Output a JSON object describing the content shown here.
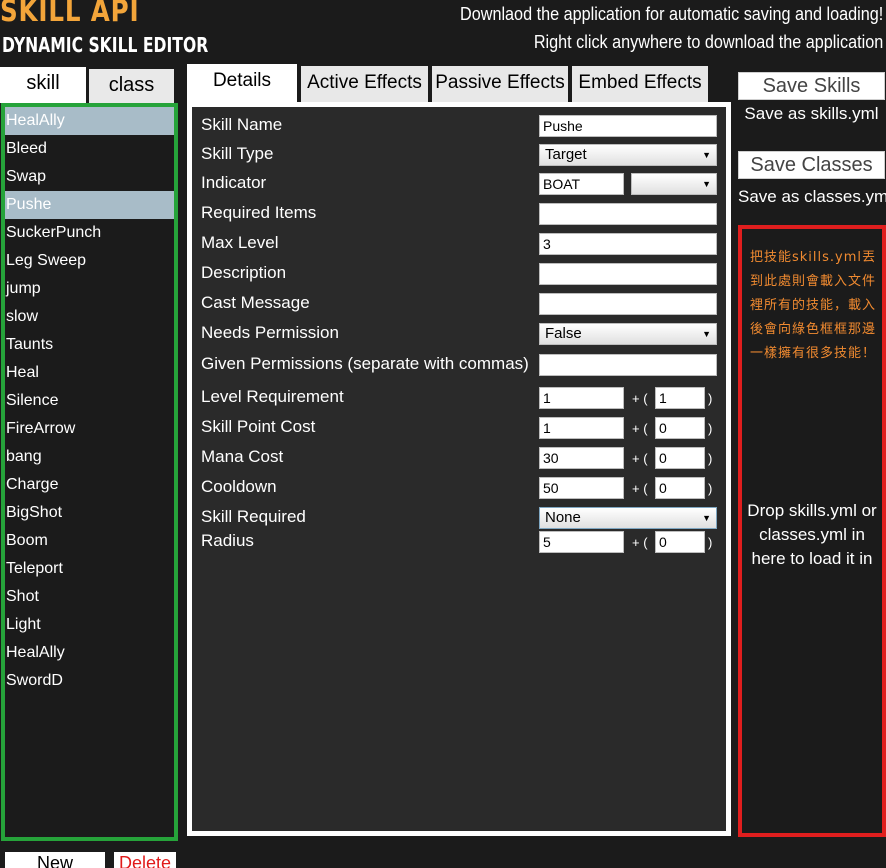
{
  "header": {
    "title": "SKILL API",
    "subtitle": "DYNAMIC SKILL EDITOR",
    "message_line1": "Downlaod the application for automatic saving and loading!",
    "message_line2": "Right click anywhere to download the application"
  },
  "left_tabs": {
    "skill": "skill",
    "class": "class"
  },
  "skill_list": [
    "HealAlly",
    "Bleed",
    "Swap",
    "Pushe",
    "SuckerPunch",
    "Leg Sweep",
    "jump",
    "slow",
    "Taunts",
    "Heal",
    "Silence",
    "FireArrow",
    "bang",
    "Charge",
    "BigShot",
    "Boom",
    "Teleport",
    "Shot",
    "Light",
    "HealAlly",
    "SwordD"
  ],
  "bottom_buttons": {
    "new": "New",
    "delete": "Delete"
  },
  "center_tabs": [
    "Details",
    "Active Effects",
    "Passive Effects",
    "Embed Effects"
  ],
  "form": {
    "skill_name": {
      "label": "Skill Name",
      "value": "Pushe"
    },
    "skill_type": {
      "label": "Skill Type",
      "value": "Target"
    },
    "indicator": {
      "label": "Indicator",
      "value": "BOAT",
      "select_value": ""
    },
    "required_items": {
      "label": "Required Items",
      "value": ""
    },
    "max_level": {
      "label": "Max Level",
      "value": "3"
    },
    "description": {
      "label": "Description",
      "value": ""
    },
    "cast_message": {
      "label": "Cast Message",
      "value": ""
    },
    "needs_permission": {
      "label": "Needs Permission",
      "value": "False"
    },
    "given_permissions": {
      "label": "Given Permissions (separate with commas)",
      "value": ""
    },
    "level_requirement": {
      "label": "Level Requirement",
      "base": "1",
      "scale": "1"
    },
    "skill_point_cost": {
      "label": "Skill Point Cost",
      "base": "1",
      "scale": "0"
    },
    "mana_cost": {
      "label": "Mana Cost",
      "base": "30",
      "scale": "0"
    },
    "cooldown": {
      "label": "Cooldown",
      "base": "50",
      "scale": "0"
    },
    "skill_required": {
      "label": "Skill Required",
      "value": "None"
    },
    "radius": {
      "label": "Radius",
      "base": "5",
      "scale": "0"
    },
    "plus_text": "+ (",
    "close_text": ")"
  },
  "right_panel": {
    "save_skills": "Save Skills",
    "save_skills_note": "Save as skills.yml",
    "save_classes": "Save Classes",
    "save_classes_note": "Save as classes.yml",
    "drop_annotation": "把技能skills.yml丟到此處則會載入文件裡所有的技能，載入後會向綠色框框那邊一樣擁有很多技能！",
    "drop_text": "Drop skills.yml or classes.yml in here to load it in"
  },
  "colors": {
    "background": "#1b1b1b",
    "logo": "#f3a53a",
    "list_border": "#26a33a",
    "drop_border": "#e01e1e",
    "selected_item": "#a8bcc8",
    "annotation": "#f08a30",
    "delete_text": "#e11a1a"
  }
}
